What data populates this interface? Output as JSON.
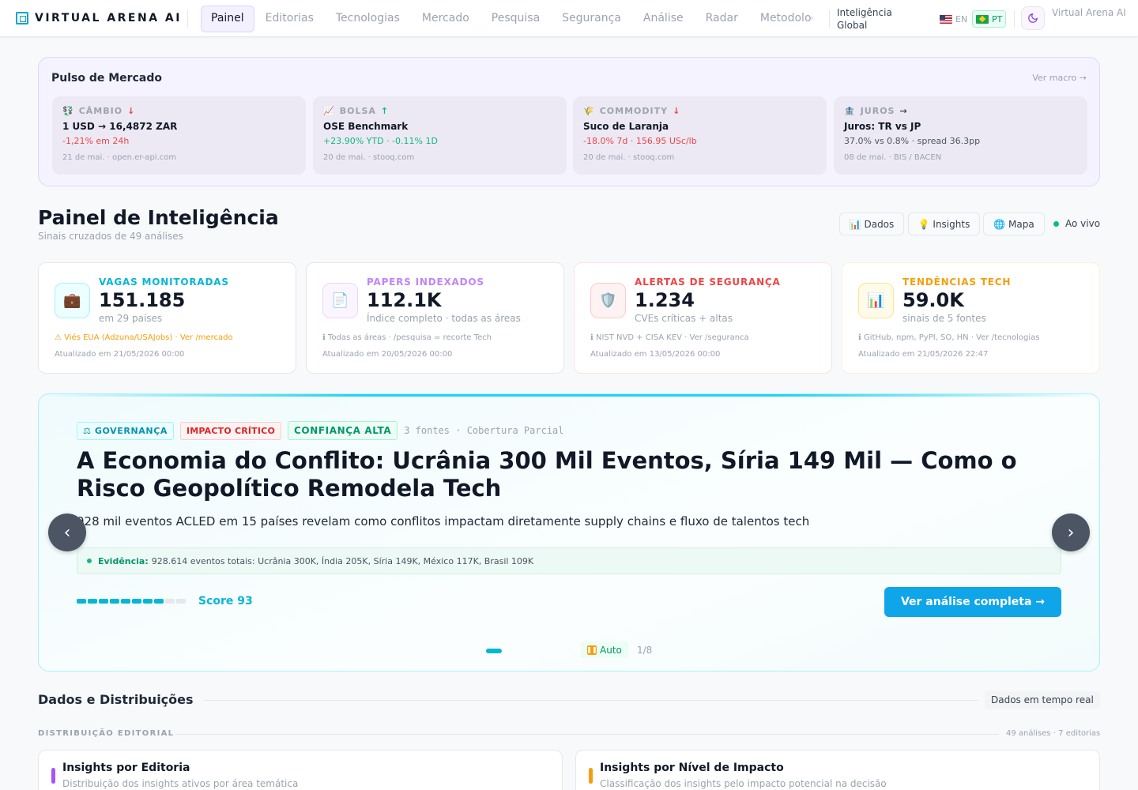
{
  "nav": {
    "brand": "VIRTUAL ARENA AI",
    "links": [
      "Painel",
      "Editorias",
      "Tecnologias",
      "Mercado",
      "Pesquisa",
      "Segurança",
      "Análise",
      "Radar",
      "Metodologia"
    ],
    "active": "Painel",
    "intel_label": "Inteligência Global",
    "lang_en": "EN",
    "lang_pt": "PT",
    "active_lang": "PT",
    "theme_icon": "moon-icon",
    "profile": "Virtual Arena AI"
  },
  "pulse": {
    "title": "Pulso de Mercado",
    "link": "Ver macro →",
    "cards": [
      {
        "icon": "💱",
        "label": "CÂMBIO",
        "arrow": "↓",
        "main": "1 USD → 16,4872 ZAR",
        "change": "-1,21% em 24h",
        "source": "21 de mai. · open.er-api.com"
      },
      {
        "icon": "📈",
        "label": "BOLSA",
        "arrow": "↑",
        "main": "OSE Benchmark",
        "change": "+23.90% YTD · -0.11% 1D",
        "source": "20 de mai. · stooq.com"
      },
      {
        "icon": "🌾",
        "label": "COMMODITY",
        "arrow": "↓",
        "main": "Suco de Laranja",
        "change": "-18.0% 7d · 156.95 USc/lb",
        "source": "20 de mai. · stooq.com"
      },
      {
        "icon": "🏦",
        "label": "JUROS",
        "arrow": "→",
        "main": "Juros: TR vs JP",
        "change": "37.0% vs 0.8% · spread 36.3pp",
        "source": "08 de mai. · BIS / BACEN"
      }
    ]
  },
  "header": {
    "title": "Painel de Inteligência",
    "subtitle": "Sinais cruzados de 49 análises",
    "btn_data": "📊 Dados",
    "btn_insights": "💡 Insights",
    "btn_map": "🌐 Mapa",
    "live": "Ao vivo"
  },
  "stats": [
    {
      "icon": "💼",
      "label": "VAGAS MONITORADAS",
      "value": "151.185",
      "desc": "em 29 países",
      "note": "⚠ Viés EUA (Adzuna/USAJobs) · Ver /mercado",
      "updated": "Atualizado em 21/05/2026 00:00",
      "color": "#06b6d4"
    },
    {
      "icon": "📄",
      "label": "PAPERS INDEXADOS",
      "value": "112.1K",
      "desc": "Índice completo · todas as áreas",
      "note": "ℹ Todas as áreas · /pesquisa = recorte Tech",
      "updated": "Atualizado em 20/05/2026 00:00",
      "color": "#c084fc"
    },
    {
      "icon": "🛡️",
      "label": "ALERTAS DE SEGURANÇA",
      "value": "1.234",
      "desc": "CVEs críticas + altas",
      "note": "ℹ NIST NVD + CISA KEV · Ver /seguranca",
      "updated": "Atualizado em 13/05/2026 00:00",
      "color": "#ef4444"
    },
    {
      "icon": "📊",
      "label": "TENDÊNCIAS TECH",
      "value": "59.0K",
      "desc": "sinais de 5 fontes",
      "note": "ℹ GitHub, npm, PyPI, SO, HN · Ver /tecnologias",
      "updated": "Atualizado em 21/05/2026 22:47",
      "color": "#f59e0b"
    }
  ],
  "hero": {
    "tag_category": "⚖ GOVERNANÇA",
    "tag_impact": "IMPACTO CRÍTICO",
    "tag_confidence": "CONFIANÇA ALTA",
    "meta": "3 fontes · Cobertura Parcial",
    "title": "A Economia do Conflito: Ucrânia 300 Mil Eventos, Síria 149 Mil — Como o Risco Geopolítico Remodela Tech",
    "subtitle": "928 mil eventos ACLED em 15 países revelam como conflitos impactam diretamente supply chains e fluxo de talentos tech",
    "evidence_label": "Evidência:",
    "evidence_text": "928.614 eventos totais: Ucrânia 300K, Índia 205K, Síria 149K, México 117K, Brasil 109K",
    "score": 93,
    "score_label": "Score 93",
    "cta": "Ver análise completa →",
    "auto": "Auto",
    "page": "1/8",
    "prev_icon": "chevron-left-icon",
    "next_icon": "chevron-right-icon"
  },
  "section": {
    "title": "Dados e Distribuições",
    "badge": "Dados em tempo real",
    "sub_title": "DISTRIBUIÇÃO EDITORIAL",
    "sub_meta": "49 análises · 7 editorias",
    "panels": [
      {
        "title": "Insights por Editoria",
        "subtitle": "Distribuição dos insights ativos por área temática",
        "color": "#a855f7"
      },
      {
        "title": "Insights por Nível de Impacto",
        "subtitle": "Classificação dos insights pelo impacto potencial na decisão",
        "color": "#f59e0b"
      }
    ]
  }
}
